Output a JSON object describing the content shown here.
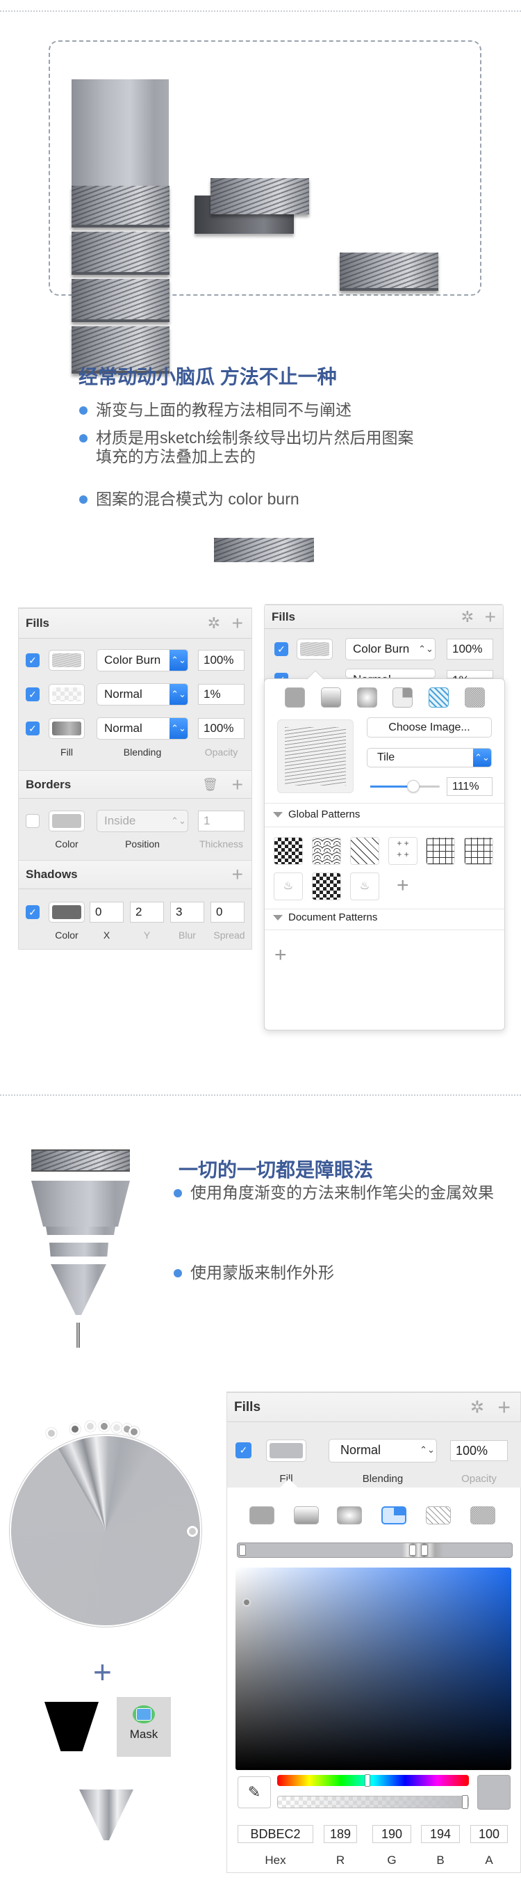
{
  "section1": {
    "title": "经常动动小脑瓜 方法不止一种",
    "bullets": [
      "渐变与上面的教程方法相同不与阐述",
      "材质是用sketch绘制条纹导出切片然后用图案填充的方法叠加上去的",
      "图案的混合模式为 color burn"
    ]
  },
  "left_panel": {
    "fills": {
      "title": "Fills",
      "rows": [
        {
          "checked": true,
          "blending": "Color Burn",
          "opacity": "100%"
        },
        {
          "checked": true,
          "blending": "Normal",
          "opacity": "1%"
        },
        {
          "checked": true,
          "blending": "Normal",
          "opacity": "100%"
        }
      ],
      "labels": {
        "fill": "Fill",
        "blending": "Blending",
        "opacity": "Opacity"
      }
    },
    "borders": {
      "title": "Borders",
      "position": "Inside",
      "thickness": "1",
      "labels": {
        "color": "Color",
        "position": "Position",
        "thickness": "Thickness"
      }
    },
    "shadows": {
      "title": "Shadows",
      "values": [
        "0",
        "2",
        "3",
        "0"
      ],
      "labels": {
        "color": "Color",
        "x": "X",
        "y": "Y",
        "blur": "Blur",
        "spread": "Spread"
      }
    }
  },
  "right_panel": {
    "title": "Fills",
    "row1": {
      "blending": "Color Burn",
      "opacity": "100%"
    },
    "row2": {
      "blending": "Normal",
      "opacity": "1%"
    },
    "popover": {
      "fill_types": [
        "solid",
        "linear-gradient",
        "radial-gradient",
        "angular-gradient",
        "pattern",
        "noise"
      ],
      "selected_type": "pattern",
      "choose_image": "Choose Image...",
      "mode": "Tile",
      "scale": "111%",
      "scale_fraction": 0.6,
      "global_patterns": "Global Patterns",
      "document_patterns": "Document Patterns"
    }
  },
  "section2": {
    "title": "一切的一切都是障眼法",
    "bullets": [
      "使用角度渐变的方法来制作笔尖的金属效果",
      "使用蒙版来制作外形"
    ]
  },
  "mask_button": "Mask",
  "bottom_panel": {
    "title": "Fills",
    "blending": "Normal",
    "opacity": "100%",
    "labels": {
      "fill": "Fill",
      "blending": "Blending",
      "opacity": "Opacity"
    },
    "selected_type": "angular-gradient",
    "color": {
      "hex": "BDBEC2",
      "r": "189",
      "g": "190",
      "b": "194",
      "a": "100"
    },
    "color_labels": {
      "hex": "Hex",
      "r": "R",
      "g": "G",
      "b": "B",
      "a": "A"
    },
    "accent": "#3d8ef0"
  }
}
